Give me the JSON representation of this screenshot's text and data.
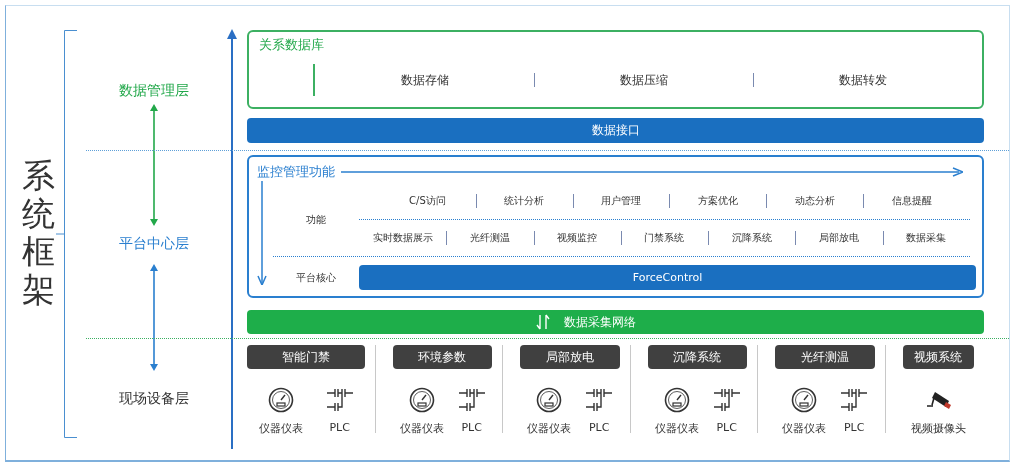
{
  "title": "系统框架",
  "layers": [
    {
      "label": "数据管理层",
      "color": "#22a84a"
    },
    {
      "label": "平台中心层",
      "color": "#2a7fcf"
    },
    {
      "label": "现场设备层",
      "color": "#333333"
    }
  ],
  "database": {
    "title": "关系数据库",
    "items": [
      "数据存储",
      "数据压缩",
      "数据转发"
    ]
  },
  "data_interface": "数据接口",
  "monitoring": {
    "title": "监控管理功能",
    "function_label": "功能",
    "function_rows": [
      [
        "C/S访问",
        "统计分析",
        "用户管理",
        "方案优化",
        "动态分析",
        "信息提醒"
      ],
      [
        "实时数据展示",
        "光纤测温",
        "视频监控",
        "门禁系统",
        "沉降系统",
        "局部放电",
        "数据采集"
      ]
    ],
    "core_label": "平台核心",
    "core": "ForceControl"
  },
  "network": "数据采集网络",
  "device_groups": [
    {
      "title": "智能门禁",
      "devices": [
        {
          "kind": "gauge",
          "label": "仪器仪表"
        },
        {
          "kind": "plc",
          "label": "PLC"
        }
      ]
    },
    {
      "title": "环境参数",
      "devices": [
        {
          "kind": "gauge",
          "label": "仪器仪表"
        },
        {
          "kind": "plc",
          "label": "PLC"
        }
      ]
    },
    {
      "title": "局部放电",
      "devices": [
        {
          "kind": "gauge",
          "label": "仪器仪表"
        },
        {
          "kind": "plc",
          "label": "PLC"
        }
      ]
    },
    {
      "title": "沉降系统",
      "devices": [
        {
          "kind": "gauge",
          "label": "仪器仪表"
        },
        {
          "kind": "plc",
          "label": "PLC"
        }
      ]
    },
    {
      "title": "光纤测温",
      "devices": [
        {
          "kind": "gauge",
          "label": "仪器仪表"
        },
        {
          "kind": "plc",
          "label": "PLC"
        }
      ]
    },
    {
      "title": "视频系统",
      "devices": [
        {
          "kind": "camera",
          "label": "视频摄像头"
        }
      ]
    }
  ]
}
